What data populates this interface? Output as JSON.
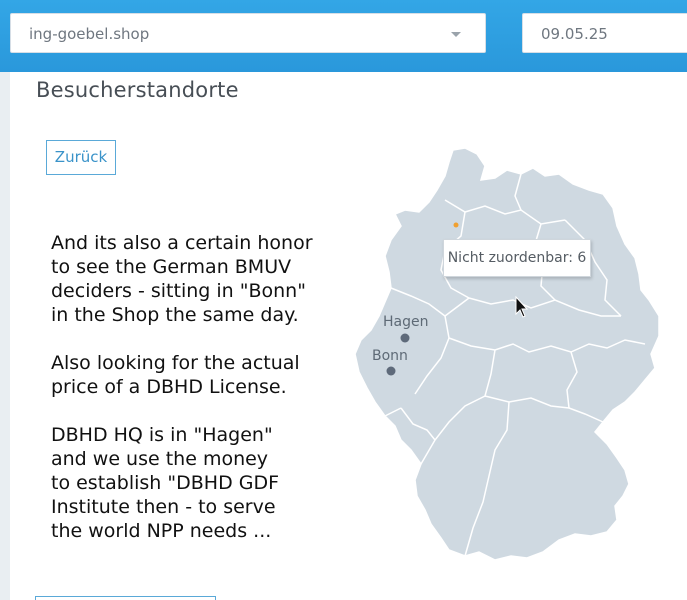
{
  "header": {
    "site_select_value": "ing-goebel.shop",
    "date_value": "09.05.25"
  },
  "panel": {
    "title": "Besucherstandorte",
    "back_label": "Zurück"
  },
  "overlay_text": {
    "paragraphs": [
      [
        "And its also a certain honor",
        "to see the German BMUV",
        "deciders - sitting in \"Bonn\"",
        "in the Shop the same day."
      ],
      [
        "Also looking for the actual",
        "price of a DBHD License."
      ],
      [
        "DBHD HQ is in \"Hagen\"",
        "and we use the money",
        "to establish \"DBHD GDF",
        "Institute then - to serve",
        "the world NPP needs ..."
      ]
    ]
  },
  "map": {
    "cities": [
      {
        "name": "Hagen"
      },
      {
        "name": "Bonn"
      }
    ],
    "tooltip": "Nicht zuordenbar: 6"
  },
  "colors": {
    "header_blue": "#2a98db",
    "map_fill": "#cfd9e1",
    "map_border": "#ffffff",
    "city_dot": "#5e6a7a",
    "unknown_dot": "#f0a030",
    "accent": "#3a93c9"
  },
  "icons": {
    "caret": "chevron-down-icon",
    "cursor": "mouse-pointer-icon"
  }
}
